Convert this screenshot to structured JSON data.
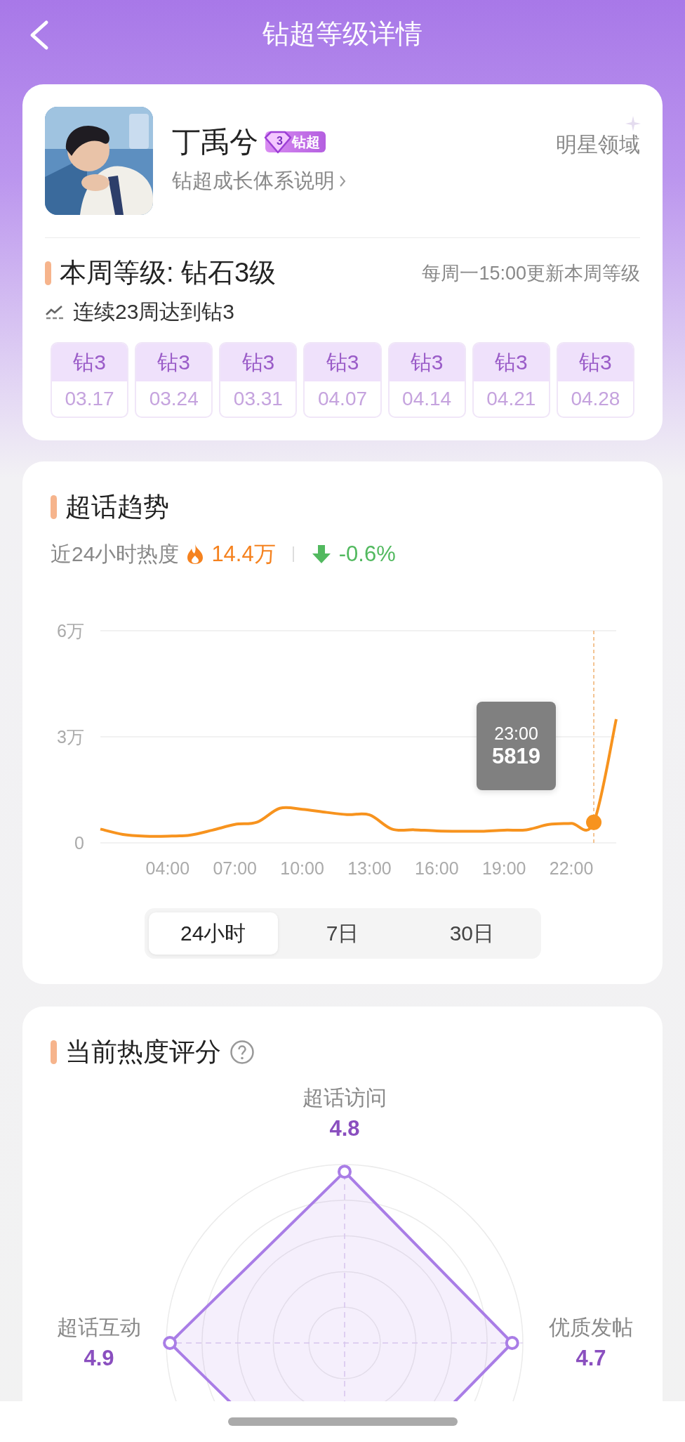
{
  "header": {
    "title": "钻超等级详情"
  },
  "profile": {
    "name": "丁禹兮",
    "badge": {
      "level": "3",
      "label": "钻超"
    },
    "link": "钻超成长体系说明",
    "domain": "明星领域"
  },
  "weekly": {
    "title": "本周等级: 钻石3级",
    "note": "每周一15:00更新本周等级",
    "streak": "连续23周达到钻3",
    "weeks": [
      {
        "level": "钻3",
        "date": "03.17"
      },
      {
        "level": "钻3",
        "date": "03.24"
      },
      {
        "level": "钻3",
        "date": "03.31"
      },
      {
        "level": "钻3",
        "date": "04.07"
      },
      {
        "level": "钻3",
        "date": "04.14"
      },
      {
        "level": "钻3",
        "date": "04.21"
      },
      {
        "level": "钻3",
        "date": "04.28"
      }
    ]
  },
  "trend": {
    "title": "超话趋势",
    "stat_label": "近24小时热度",
    "heat": "14.4万",
    "change": "-0.6%",
    "tooltip": {
      "time": "23:00",
      "value": "5819"
    },
    "chart_data": {
      "type": "line",
      "x": [
        1,
        2,
        3,
        4,
        5,
        6,
        7,
        8,
        9,
        10,
        11,
        12,
        13,
        14,
        15,
        16,
        17,
        18,
        19,
        20,
        21,
        22,
        23,
        24
      ],
      "series": [
        {
          "color": "#f7931e",
          "values": [
            0.39,
            0.24,
            0.19,
            0.19,
            0.22,
            0.36,
            0.52,
            0.59,
            0.98,
            0.95,
            0.87,
            0.8,
            0.79,
            0.39,
            0.37,
            0.34,
            0.33,
            0.33,
            0.36,
            0.37,
            0.52,
            0.55,
            0.58,
            3.5
          ]
        }
      ],
      "xlim": [
        1,
        24
      ],
      "ylim": [
        0,
        6
      ],
      "xticks": [
        {
          "value": 4,
          "label": "04:00"
        },
        {
          "value": 7,
          "label": "07:00"
        },
        {
          "value": 10,
          "label": "10:00"
        },
        {
          "value": 13,
          "label": "13:00"
        },
        {
          "value": 16,
          "label": "16:00"
        },
        {
          "value": 19,
          "label": "19:00"
        },
        {
          "value": 22,
          "label": "22:00"
        }
      ],
      "yticks": [
        {
          "value": 0,
          "label": "0"
        },
        {
          "value": 3,
          "label": "3万"
        },
        {
          "value": 6,
          "label": "6万"
        }
      ],
      "ref_lines": [
        {
          "axis": "x",
          "value": 23
        }
      ]
    },
    "ranges": [
      {
        "label": "24小时",
        "selected": true
      },
      {
        "label": "7日",
        "selected": false
      },
      {
        "label": "30日",
        "selected": false
      }
    ]
  },
  "score": {
    "title": "当前热度评分",
    "axes": [
      {
        "label": "超话访问",
        "value": "4.8"
      },
      {
        "label": "超话互动",
        "value": "4.9"
      },
      {
        "label": "优质发帖",
        "value": "4.7"
      }
    ]
  }
}
